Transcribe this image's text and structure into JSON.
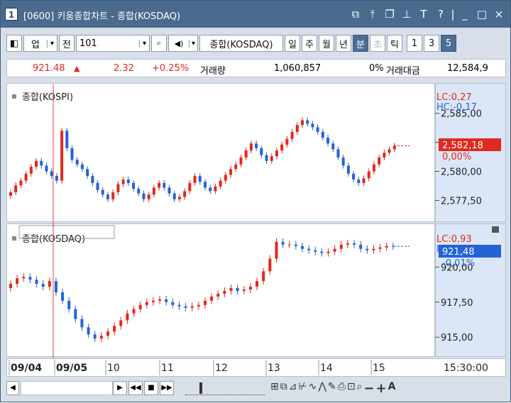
{
  "window": {
    "number": "1",
    "title": "[0600] 키움종합차트 - 종합(KOSDAQ)"
  },
  "title_icons": [
    "restore-icon",
    "pin-icon",
    "cascade-icon",
    "pushpin-icon",
    "font-icon",
    "help-icon",
    "minimize-icon",
    "maximize-icon",
    "close-icon"
  ],
  "toolbar": {
    "panel_toggle": "◧",
    "market_label": "업",
    "dropdown_arrow": "▾",
    "all_label": "전",
    "code_value": "101",
    "search_glyph": "🔍",
    "speaker_glyph": "🔈",
    "index_name": "종합(KOSDAQ)",
    "periods": [
      "일",
      "주",
      "월",
      "년",
      "분",
      "초",
      "틱"
    ],
    "selected_period": "분",
    "intervals": [
      "1",
      "3",
      "5"
    ],
    "selected_interval": "5"
  },
  "info": {
    "price": "921.48",
    "arrow": "▲",
    "change": "2.32",
    "change_pct": "+0.25%",
    "volume_label": "거래량",
    "volume": "1,060,857",
    "vol_pct": "0%",
    "amount_label": "거래대금",
    "amount": "12,584,9"
  },
  "upper_pane": {
    "legend": "종합(KOSPI)",
    "lc": "LC:0,27",
    "hc": "HC:-0,17",
    "ticks": [
      "2,585,00",
      "2,582,50",
      "2,580,00",
      "2,577,50"
    ],
    "last_price": "2,582,18",
    "last_pct": "0,00%"
  },
  "lower_pane": {
    "legend": "종합(KOSDAQ)",
    "lc": "LC:0,93",
    "hc": "HC:-0,13",
    "ticks": [
      "920,00",
      "917,50",
      "915,00"
    ],
    "last_price": "921,48",
    "last_pct": "-0,01%"
  },
  "xaxis": {
    "labels": [
      "09/04",
      "09/05",
      "10",
      "11",
      "12",
      "13",
      "14",
      "15"
    ],
    "time": "15:30:00"
  },
  "colors": {
    "up": "#e0291f",
    "down": "#2463d6",
    "axis_bg": "#dbe7f6",
    "title_bg": "#4a6a8e",
    "selected": "#4c6d94",
    "cursor": "#d83c3c"
  },
  "chart_data": [
    {
      "type": "candlestick",
      "title": "종합(KOSPI)",
      "ylim": [
        2576,
        2587
      ],
      "series": [
        {
          "name": "종합(KOSPI)",
          "values": [
            2578.2,
            2578.8,
            2579.2,
            2579.8,
            2580.4,
            2580.9,
            2580.5,
            2580.0,
            2579.6,
            2579.2,
            2583.5,
            2582.0,
            2581.0,
            2580.6,
            2580.2,
            2579.6,
            2579.0,
            2578.4,
            2578.0,
            2577.6,
            2578.2,
            2578.9,
            2579.3,
            2579.0,
            2578.5,
            2578.1,
            2577.6,
            2578.0,
            2578.6,
            2579.0,
            2578.6,
            2578.1,
            2577.6,
            2577.8,
            2578.3,
            2579.0,
            2579.6,
            2579.1,
            2578.6,
            2578.3,
            2578.7,
            2579.2,
            2579.7,
            2580.2,
            2580.6,
            2581.2,
            2581.8,
            2582.4,
            2582.0,
            2581.4,
            2580.9,
            2581.3,
            2581.8,
            2582.3,
            2582.8,
            2583.4,
            2584.0,
            2584.4,
            2584.1,
            2583.8,
            2583.4,
            2582.9,
            2582.4,
            2581.9,
            2581.2,
            2580.5,
            2579.8,
            2579.3,
            2579.0,
            2579.4,
            2580.0,
            2580.6,
            2581.2,
            2581.6,
            2581.9,
            2582.2
          ]
        }
      ]
    },
    {
      "type": "candlestick",
      "title": "종합(KOSDAQ)",
      "ylim": [
        914,
        922.5
      ],
      "series": [
        {
          "name": "종합(KOSDAQ)",
          "values": [
            918.8,
            919.2,
            919.3,
            919.1,
            918.8,
            918.6,
            919.0,
            918.2,
            917.6,
            917.0,
            916.3,
            915.7,
            915.2,
            914.9,
            915.1,
            915.4,
            915.8,
            916.2,
            916.7,
            917.0,
            917.3,
            917.5,
            917.6,
            917.7,
            917.5,
            917.3,
            917.2,
            917.1,
            917.2,
            917.3,
            917.6,
            917.9,
            918.1,
            918.3,
            918.5,
            918.3,
            918.4,
            918.6,
            919.0,
            919.7,
            920.6,
            921.8,
            921.6,
            921.6,
            921.5,
            921.3,
            921.2,
            921.1,
            921.0,
            921.1,
            921.3,
            921.6,
            921.7,
            921.6,
            921.3,
            921.2,
            921.3,
            921.4,
            921.5,
            921.48
          ]
        }
      ]
    }
  ]
}
